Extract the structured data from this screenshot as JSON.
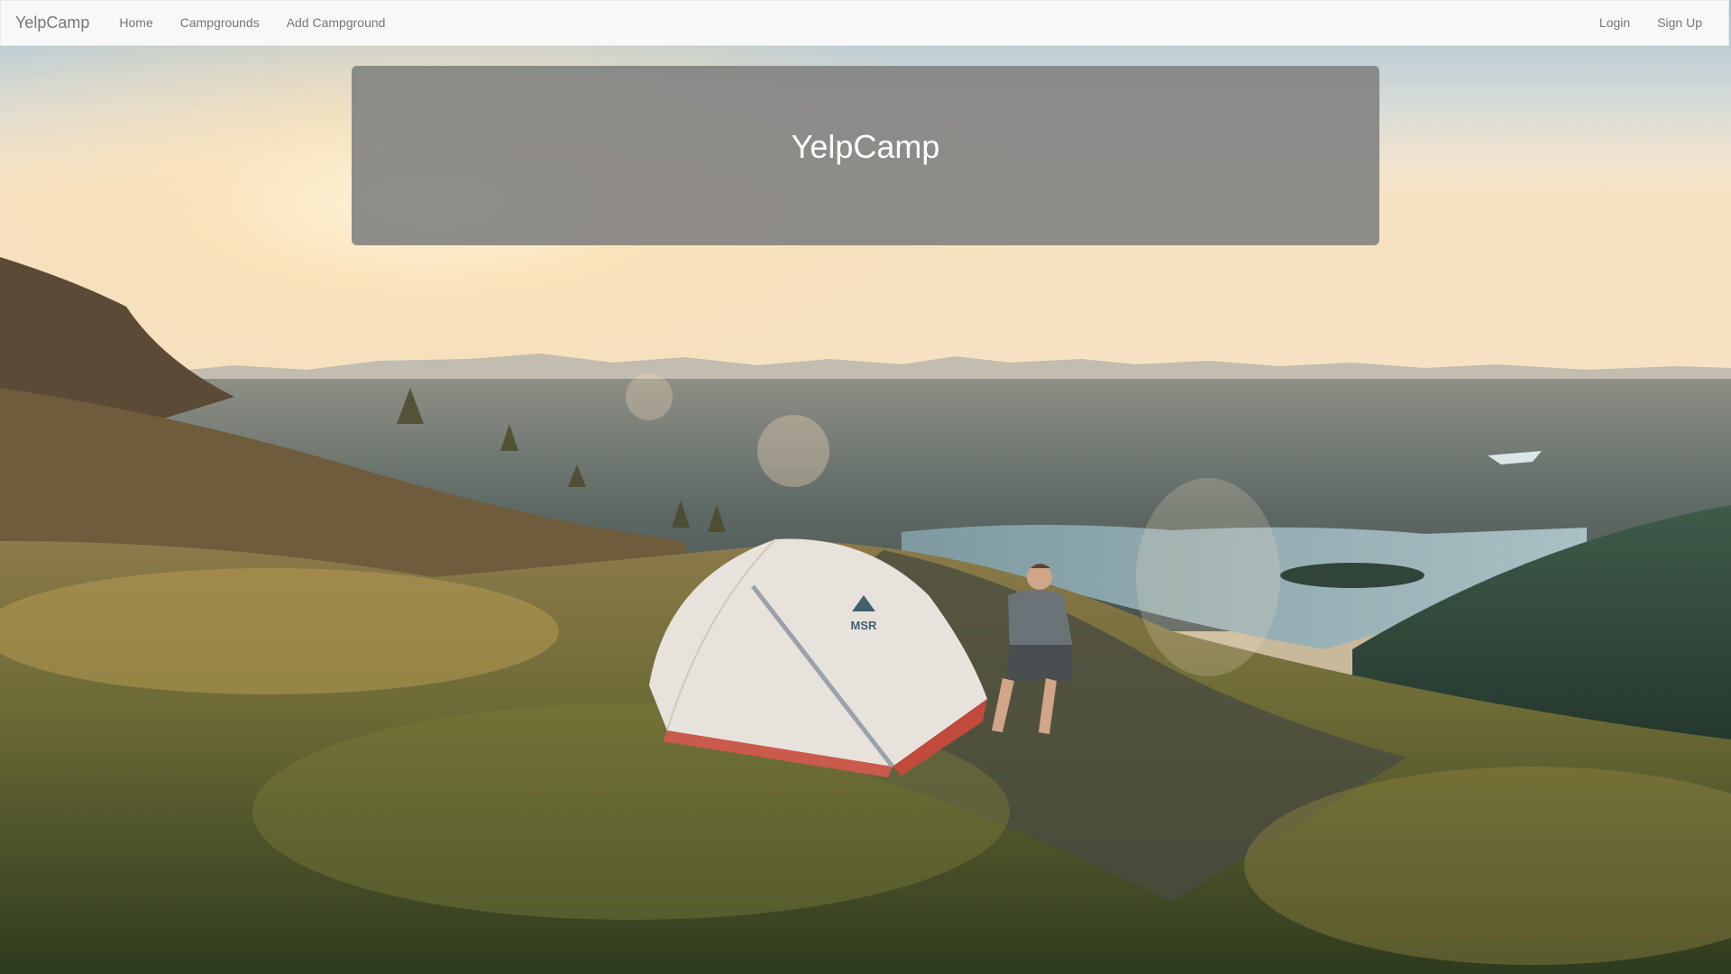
{
  "navbar": {
    "brand": "YelpCamp",
    "left_links": [
      {
        "label": "Home"
      },
      {
        "label": "Campgrounds"
      },
      {
        "label": "Add Campground"
      }
    ],
    "right_links": [
      {
        "label": "Login"
      },
      {
        "label": "Sign Up"
      }
    ]
  },
  "jumbotron": {
    "title": "YelpCamp"
  },
  "background": {
    "tent_brand": "MSR"
  },
  "colors": {
    "navbar_bg": "#f8f8f8",
    "nav_text": "#777777",
    "jumbotron_bg": "#808080",
    "jumbotron_text": "#ffffff"
  }
}
